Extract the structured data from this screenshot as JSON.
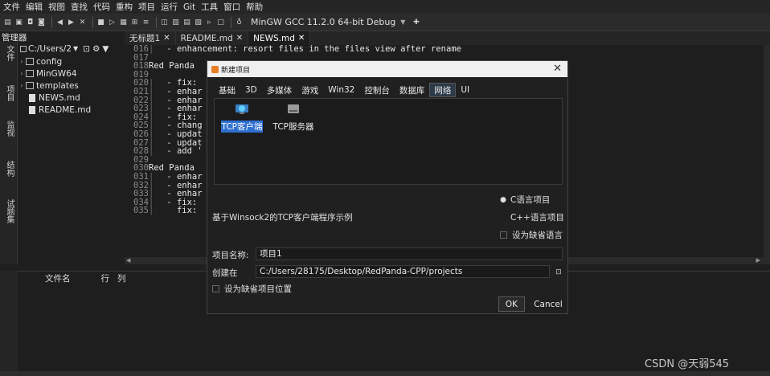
{
  "menu": [
    "文件",
    "编辑",
    "视图",
    "查找",
    "代码",
    "重构",
    "项目",
    "运行",
    "Git",
    "工具",
    "窗口",
    "帮助"
  ],
  "toolbar": {
    "compiler": "MinGW GCC 11.2.0 64-bit Debug"
  },
  "left_panel": {
    "title": "管理器",
    "path": "C:/Users/2",
    "vtabs": [
      "文件",
      "项目",
      "监视",
      "结构",
      "试题集"
    ],
    "tree": [
      {
        "type": "folder",
        "name": "config"
      },
      {
        "type": "folder",
        "name": "MinGW64"
      },
      {
        "type": "folder",
        "name": "templates"
      },
      {
        "type": "file",
        "name": "NEWS.md"
      },
      {
        "type": "file",
        "name": "README.md"
      }
    ]
  },
  "editor": {
    "tabs": [
      {
        "label": "无标题1",
        "active": false
      },
      {
        "label": "README.md",
        "active": false
      },
      {
        "label": "NEWS.md",
        "active": true
      }
    ],
    "lines": [
      {
        "n": "016",
        "g": "|",
        "t": " - enhancement: resort files in the files view after rename"
      },
      {
        "n": "017",
        "g": "",
        "t": ""
      },
      {
        "n": "018",
        "g": "Red Panda",
        "t": ""
      },
      {
        "n": "019",
        "g": "",
        "t": ""
      },
      {
        "n": "020",
        "g": "|",
        "t": " - fix:"
      },
      {
        "n": "021",
        "g": "|",
        "t": " - enhar"
      },
      {
        "n": "022",
        "g": "|",
        "t": " - enhar"
      },
      {
        "n": "023",
        "g": "|",
        "t": " - enhar"
      },
      {
        "n": "024",
        "g": "|",
        "t": " - fix:"
      },
      {
        "n": "025",
        "g": "|",
        "t": " - chang"
      },
      {
        "n": "026",
        "g": "|",
        "t": " - updat"
      },
      {
        "n": "027",
        "g": "|",
        "t": " - updat"
      },
      {
        "n": "028",
        "g": "|",
        "t": " - add '"
      },
      {
        "n": "029",
        "g": "",
        "t": ""
      },
      {
        "n": "030",
        "g": "Red Panda",
        "t": ""
      },
      {
        "n": "031",
        "g": "|",
        "t": " - enhar                                                   mpletion popup window"
      },
      {
        "n": "032",
        "g": "|",
        "t": " - enhar"
      },
      {
        "n": "033",
        "g": "|",
        "t": " - enhar                                                    compiler options"
      },
      {
        "n": "034",
        "g": "|",
        "t": " - fix:"
      },
      {
        "n": "035",
        "g": "|",
        "t": "   fix:"
      }
    ]
  },
  "bottom": {
    "cols": [
      "文件名",
      "行",
      "列"
    ]
  },
  "dialog": {
    "title": "新建项目",
    "categories": [
      "基础",
      "3D",
      "多媒体",
      "游戏",
      "Win32",
      "控制台",
      "数据库",
      "网络",
      "UI"
    ],
    "active_category": "网络",
    "templates": [
      {
        "label": "TCP客户端",
        "selected": true
      },
      {
        "label": "TCP服务器",
        "selected": false
      }
    ],
    "description": "基于Winsock2的TCP客户端程序示例",
    "language_c": "C语言项目",
    "language_cpp": "C++语言项目",
    "default_language": "设为缺省语言",
    "name_label": "项目名称:",
    "name_value": "项目1",
    "location_label": "创建在",
    "location_value": "C:/Users/28175/Desktop/RedPanda-CPP/projects",
    "default_location": "设为缺省项目位置",
    "ok": "OK",
    "cancel": "Cancel"
  },
  "watermark": "CSDN @天弱545",
  "colors": {
    "accent": "#2f6fd0",
    "titlebar_logo": "#e67e22"
  }
}
